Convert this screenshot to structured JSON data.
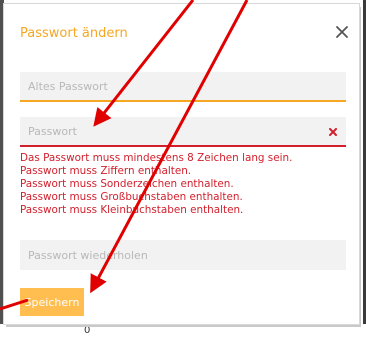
{
  "dialog": {
    "title": "Passwort ändern",
    "close_icon": "close-icon"
  },
  "fields": {
    "old_password": {
      "placeholder": "Altes Passwort",
      "value": ""
    },
    "new_password": {
      "placeholder": "Passwort",
      "value": "",
      "clear_icon": "clear-icon"
    },
    "repeat_password": {
      "placeholder": "Passwort wiederholen",
      "value": ""
    }
  },
  "errors": [
    "Das Passwort muss mindestens 8 Zeichen lang sein.",
    "Passwort muss Ziffern enthalten.",
    "Passwort muss Sonderzeichen enthalten.",
    "Passwort muss Großbuchstaben enthalten.",
    "Passwort muss Kleinbuchstaben enthalten."
  ],
  "actions": {
    "save_label": "Speichern"
  },
  "background": {
    "glyph": "0"
  },
  "colors": {
    "accent": "#f5a623",
    "error": "#d21f2c",
    "button": "#ffbe4f",
    "annotation": "#e00000"
  }
}
